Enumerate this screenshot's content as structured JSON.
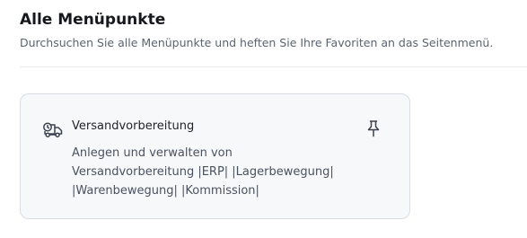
{
  "header": {
    "title": "Alle Menüpunkte",
    "subtitle": "Durchsuchen Sie alle Menüpunkte und heften Sie Ihre Favoriten an das Seitenmenü."
  },
  "menu_items": [
    {
      "icon": "truck-clock-icon",
      "title": "Versandvorbereitung",
      "description_lines": [
        "Anlegen und verwalten von",
        "Versandvorbereitung |ERP| |Lagerbewegung|",
        "|Warenbewegung| |Kommission|"
      ],
      "pin_icon": "pin-icon"
    }
  ],
  "colors": {
    "card_background": "#f7f8fa",
    "card_border": "#d9dde3",
    "divider": "#e6e8ec"
  }
}
